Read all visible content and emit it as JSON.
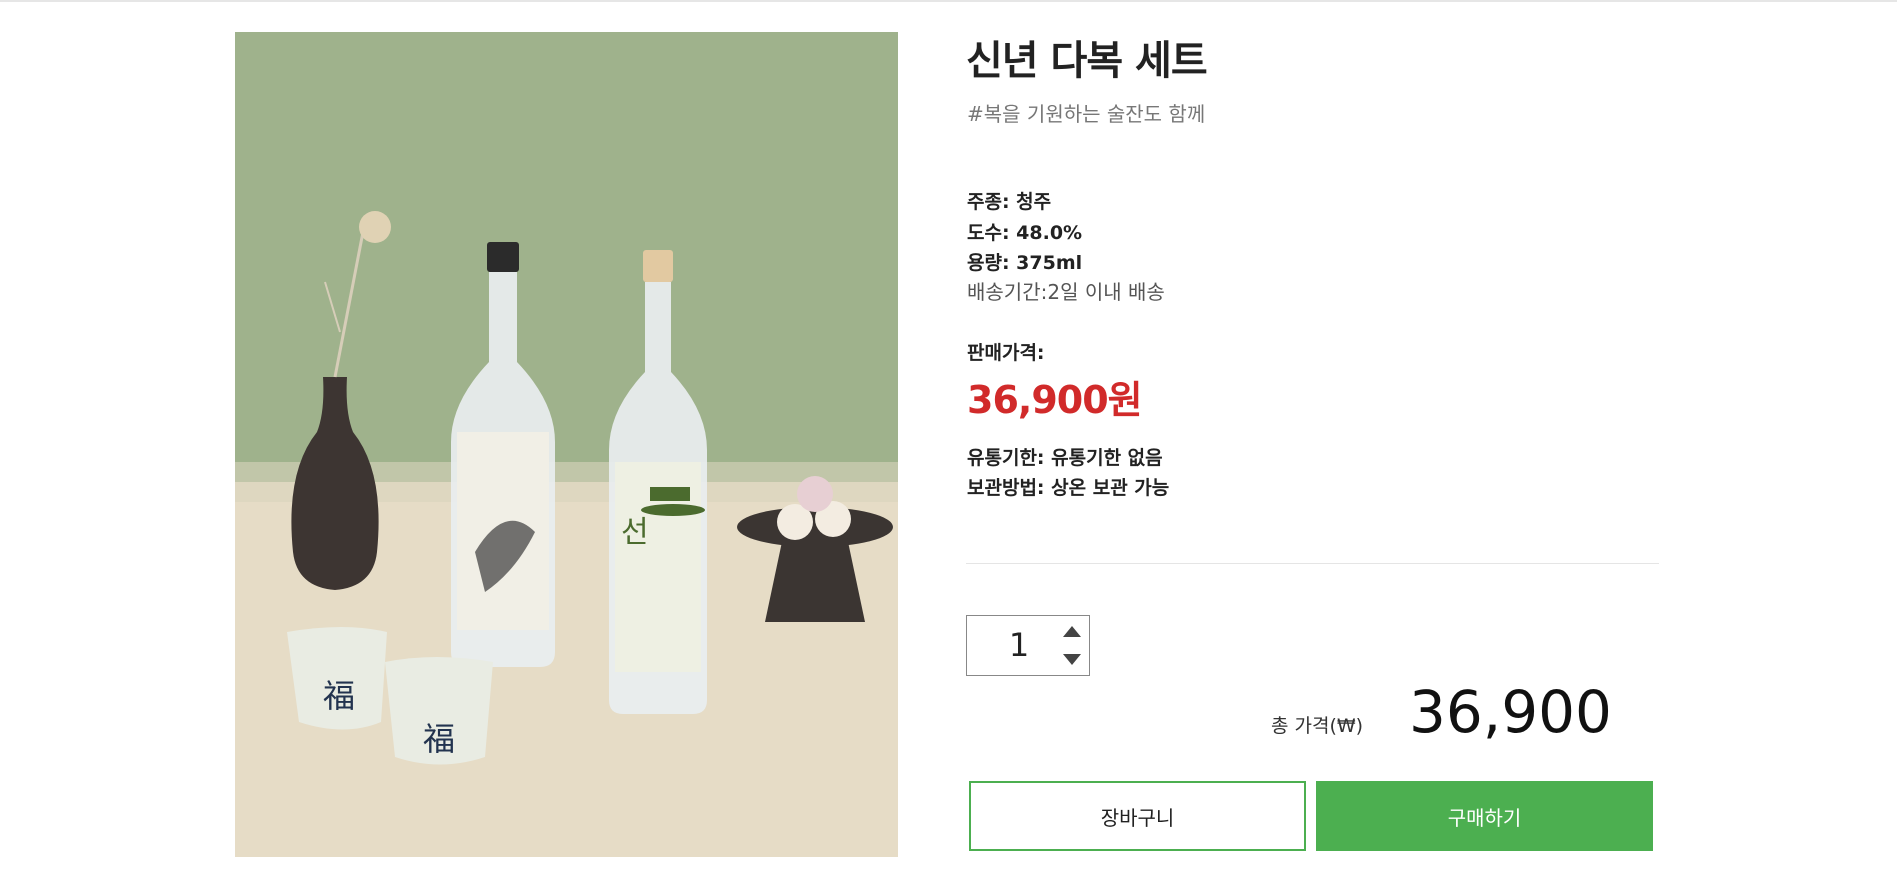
{
  "product": {
    "title": "신년 다복 세트",
    "tagline": "#복을 기원하는 술잔도 함께",
    "image_alt": "tokki soju and sonbi bottles with cups",
    "specs": {
      "type": "주종: 청주",
      "abv": "도수: 48.0%",
      "volume": "용량: 375ml",
      "shipping": "배송기간:2일 이내 배송"
    },
    "price_label": "판매가격:",
    "price": "36,900원",
    "expiry": "유통기한: 유통기한 없음",
    "storage": "보관방법: 상온 보관 가능"
  },
  "order": {
    "quantity": "1",
    "total_label": "총 가격(₩)",
    "total_value": "36,900"
  },
  "buttons": {
    "cart": "장바구니",
    "buy": "구매하기"
  },
  "colors": {
    "accent_green": "#4caf50",
    "price_red": "#d12a2a"
  }
}
